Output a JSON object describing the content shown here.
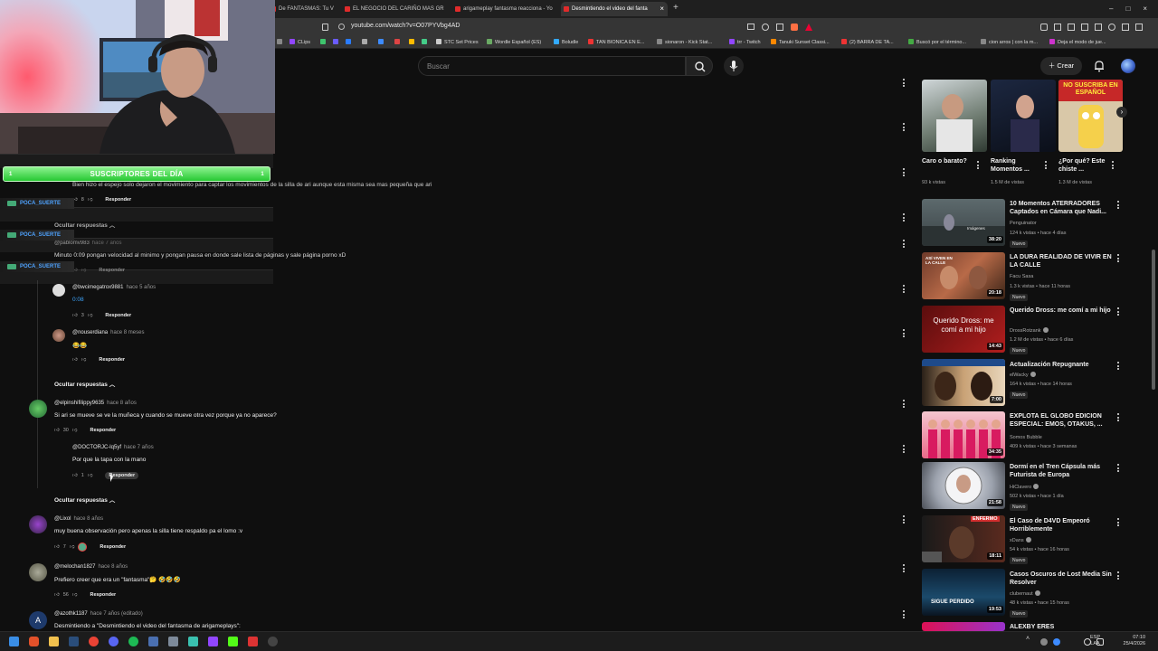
{
  "browser": {
    "tabs": [
      {
        "label": "De FANTASMAS: Tu V"
      },
      {
        "label": "EL NEGOCIO DEL CARIÑO MAS GR"
      },
      {
        "label": "arigameplay fantasma reacciona - Yo"
      },
      {
        "label": "Desmintiendo el video del fanta"
      }
    ],
    "new_tab": "+",
    "close_tab": "×",
    "window_controls": [
      "‒",
      "□",
      "×"
    ],
    "url": "youtube.com/watch?v=O07PYVbg4AD",
    "bookmarks": [
      "CLips",
      "STC Set Prices",
      "Wordle Español (ES)",
      "Boludle",
      "TAN BIONICA EN E...",
      "sionaron - Kick Stat...",
      "trr - Twitch",
      "Tanuki Sunset Classi...",
      "(2) BARRA DE TA...",
      "Buscó por el término...",
      "cion arros | con la m...",
      "Deja el modo de jue..."
    ]
  },
  "youtube": {
    "search_placeholder": "Buscar",
    "create_label": "Crear"
  },
  "overlay": {
    "banner": "SUSCRIPTORES DEL DÍA",
    "banner_left": "1",
    "banner_right": "1",
    "tags": [
      "POCA_SUERTE",
      "POCA_SUERTE",
      "POCA_SUERTE"
    ]
  },
  "comments": {
    "partial_top": "Bien hizo el espejo solo dejaron el movimiento para captar los movimientos de la silla de ari aunque esta misma sea mas pequeña que ari",
    "partial_likes": "8",
    "hide_replies": "Ocultar respuestas",
    "reply_label": "Responder",
    "items": [
      {
        "user": "@pablomv983",
        "time": "hace 7 años",
        "text": "Minuto 0:09 pongan velocidad al minimo y pongan pausa en donde sale lista de páginas y sale página porno xD",
        "likes": ""
      },
      {
        "user": "@bwcimegatrox9881",
        "time": "hace 5 años",
        "text": "0:08",
        "likes": "3"
      },
      {
        "user": "@nouserdiana",
        "time": "hace 8 meses",
        "text": "😂😂",
        "likes": ""
      },
      {
        "user": "@elpinshifilippy9635",
        "time": "hace 8 años",
        "text": "Si ari se mueve se ve la muñeca y cuando se mueve otra vez porque ya no aparece?",
        "likes": "30"
      },
      {
        "user": "@DOCTORJC-lq5yf",
        "time": "hace 7 años",
        "text": "Por que la tapa con la mano",
        "likes": "1"
      },
      {
        "user": "@Lixol",
        "time": "hace 8 años",
        "text": "muy buena observación pero apenas la silla tiene respaldo pa el lomo :v",
        "likes": "7"
      },
      {
        "user": "@melochan1827",
        "time": "hace 8 años",
        "text": "Prefiero creer que era un \"fantasma\"🤔 🤣🤣🤣",
        "likes": "56"
      },
      {
        "user": "@azothk1187",
        "time": "hace 7 años (editado)",
        "text": "Desmintiendo a \"Desmintiendo el video del fantasma de arigameplays\":",
        "likes": "",
        "avatar_letter": "A"
      }
    ]
  },
  "shorts": [
    {
      "title": "Caro o barato?",
      "views": "93 k vistas"
    },
    {
      "title": "Ranking Momentos ...",
      "views": "1.5 M de vistas"
    },
    {
      "title": "¿Por qué? Este chiste ...",
      "views": "1.3 M de vistas",
      "thumb_text": "NO SUSCRIBA EN ESPAÑOL"
    }
  ],
  "recommendations": [
    {
      "title": "10 Momentos ATERRADORES Captados en Cámara que Nadi...",
      "channel": "Penguinator",
      "meta": "124 k vistas • hace 4 días",
      "duration": "38:20",
      "new": "Nuevo",
      "verified": false,
      "thumb_caption": "Imágenes"
    },
    {
      "title": "LA DURA REALIDAD DE VIVIR EN LA CALLE",
      "channel": "Facu Sasa",
      "meta": "1.3 k vistas • hace 11 horas",
      "duration": "20:18",
      "new": "Nuevo",
      "verified": false,
      "thumb_caption": "ASÍ VIVEN EN LA CALLE"
    },
    {
      "title": "Querido Dross: me comí a mi hijo",
      "channel": "DrossRotzank",
      "meta": "1.2 M de vistas • hace 6 días",
      "duration": "14:43",
      "new": "Nuevo",
      "verified": true,
      "thumb_caption": "Querido Dross: me comí a mi hijo"
    },
    {
      "title": "Actualización Repugnante",
      "channel": "elWacky",
      "meta": "164 k vistas • hace 14 horas",
      "duration": "7:00",
      "new": "Nuevo",
      "verified": true,
      "thumb_caption": ""
    },
    {
      "title": "EXPLOTA EL GLOBO EDICION ESPECIAL: EMOS, OTAKUS, ...",
      "channel": "Somos Bubble",
      "meta": "409 k vistas • hace 3 semanas",
      "duration": "34:35",
      "new": "",
      "verified": false,
      "thumb_caption": ""
    },
    {
      "title": "Dormí en el Tren Cápsula más Futurista de Europa",
      "channel": "HiClavero",
      "meta": "502 k vistas • hace 1 día",
      "duration": "21:58",
      "new": "Nuevo",
      "verified": true,
      "thumb_caption": ""
    },
    {
      "title": "El Caso de D4VD Empeoró Horriblemente",
      "channel": "xDans",
      "meta": "54 k vistas • hace 16 horas",
      "duration": "18:11",
      "new": "Nuevo",
      "verified": true,
      "thumb_caption": "ENFERMO"
    },
    {
      "title": "Casos Oscuros de Lost Media Sin Resolver",
      "channel": "clubernaut",
      "meta": "48 k vistas • hace 15 horas",
      "duration": "19:53",
      "new": "Nuevo",
      "verified": true,
      "thumb_caption": "SIGUE PERDIDO"
    },
    {
      "title": "ALEXBY ERES",
      "channel": "",
      "meta": "",
      "duration": "",
      "new": "",
      "verified": false,
      "thumb_caption": ""
    }
  ],
  "taskbar": {
    "lang_top": "ESP",
    "lang_bottom": "LAA",
    "time": "07:10",
    "date": "25/4/2026"
  },
  "colors": {
    "bg": "#0f0f0f",
    "banner_green": "#26c832",
    "tag_blue": "#4fa3ff",
    "yt_red": "#ff0000"
  }
}
